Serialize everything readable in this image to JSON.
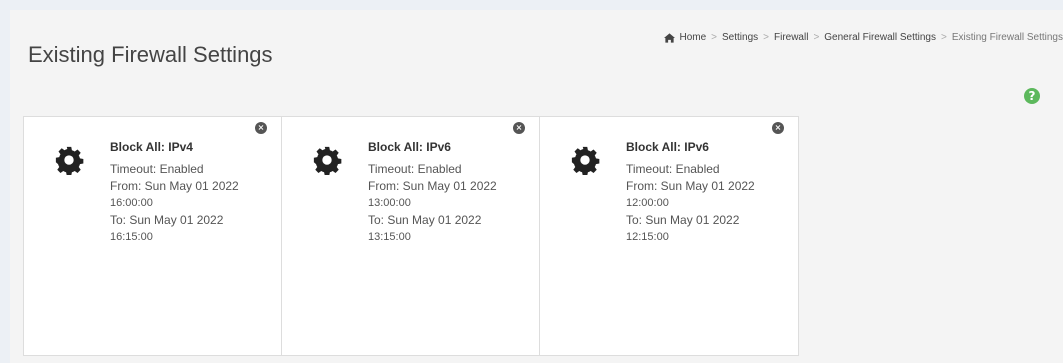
{
  "header": {
    "title": "Existing Firewall Settings"
  },
  "breadcrumb": {
    "items": [
      "Home",
      "Settings",
      "Firewall",
      "General Firewall Settings",
      "Existing Firewall Settings"
    ],
    "separator": ">"
  },
  "help_label": "?",
  "cards": [
    {
      "name": "Block All: IPv4",
      "timeout": "Timeout: Enabled",
      "from_date": "From: Sun May 01 2022",
      "from_time": "16:00:00",
      "to_date": "To: Sun May 01 2022",
      "to_time": "16:15:00",
      "icon": "gear-icon",
      "close_label": "×"
    },
    {
      "name": "Block All: IPv6",
      "timeout": "Timeout: Enabled",
      "from_date": "From: Sun May 01 2022",
      "from_time": "13:00:00",
      "to_date": "To: Sun May 01 2022",
      "to_time": "13:15:00",
      "icon": "gear-icon",
      "close_label": "×"
    },
    {
      "name": "Block All: IPv6",
      "timeout": "Timeout: Enabled",
      "from_date": "From: Sun May 01 2022",
      "from_time": "12:00:00",
      "to_date": "To: Sun May 01 2022",
      "to_time": "12:15:00",
      "icon": "gear-icon",
      "close_label": "×"
    }
  ],
  "colors": {
    "help": "#5cb85c",
    "gear": "#222222",
    "close": "#555555"
  }
}
